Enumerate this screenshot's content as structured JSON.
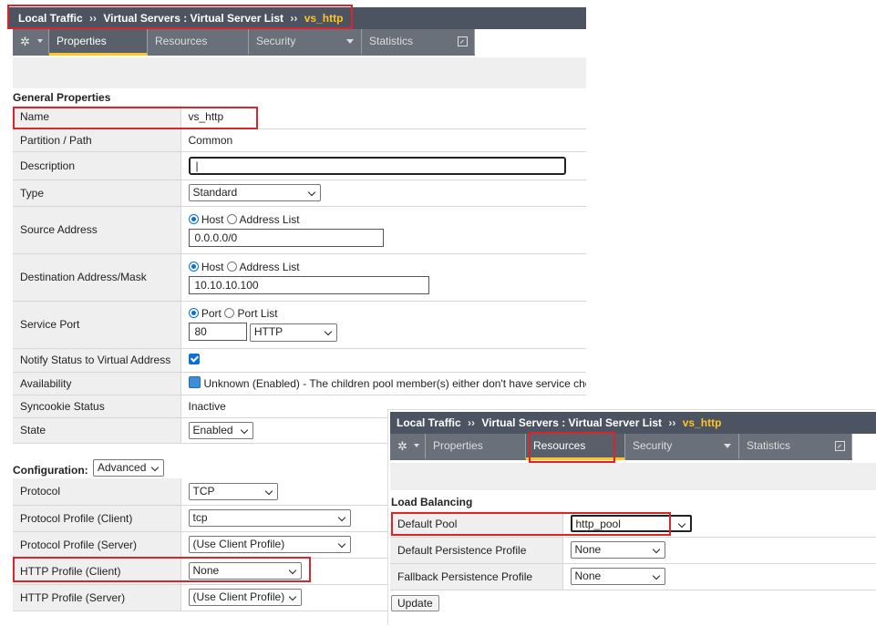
{
  "properties_panel": {
    "breadcrumb": {
      "part1": "Local Traffic",
      "sep": "››",
      "part2": "Virtual Servers : Virtual Server List",
      "current": "vs_http"
    },
    "tabs": {
      "properties": "Properties",
      "resources": "Resources",
      "security": "Security",
      "statistics": "Statistics"
    },
    "general_title": "General Properties",
    "name_label": "Name",
    "name_value": "vs_http",
    "partition_label": "Partition / Path",
    "partition_value": "Common",
    "description_label": "Description",
    "description_value": "|",
    "type_label": "Type",
    "type_value": "Standard",
    "source_label": "Source Address",
    "source_host": "Host",
    "source_list": "Address List",
    "source_value": "0.0.0.0/0",
    "dest_label": "Destination Address/Mask",
    "dest_host": "Host",
    "dest_list": "Address List",
    "dest_value": "10.10.10.100",
    "port_label": "Service Port",
    "port_opt": "Port",
    "port_list": "Port List",
    "port_value": "80",
    "port_service": "HTTP",
    "notify_label": "Notify Status to Virtual Address",
    "availability_label": "Availability",
    "availability_value": "Unknown (Enabled) - The children pool member(s) either don't have service che",
    "syncookie_label": "Syncookie Status",
    "syncookie_value": "Inactive",
    "state_label": "State",
    "state_value": "Enabled",
    "config_label": "Configuration:",
    "config_mode": "Advanced",
    "protocol_label": "Protocol",
    "protocol_value": "TCP",
    "pp_client_label": "Protocol Profile (Client)",
    "pp_client_value": "tcp",
    "pp_server_label": "Protocol Profile (Server)",
    "pp_server_value": "(Use Client Profile)",
    "http_client_label": "HTTP Profile (Client)",
    "http_client_value": "None",
    "http_server_label": "HTTP Profile (Server)",
    "http_server_value": "(Use Client Profile)"
  },
  "resources_panel": {
    "breadcrumb": {
      "part1": "Local Traffic",
      "sep": "››",
      "part2": "Virtual Servers : Virtual Server List",
      "current": "vs_http"
    },
    "tabs": {
      "properties": "Properties",
      "resources": "Resources",
      "security": "Security",
      "statistics": "Statistics"
    },
    "lb_title": "Load Balancing",
    "default_pool_label": "Default Pool",
    "default_pool_value": "http_pool",
    "default_persist_label": "Default Persistence Profile",
    "default_persist_value": "None",
    "fallback_persist_label": "Fallback Persistence Profile",
    "fallback_persist_value": "None",
    "update_button": "Update"
  },
  "colors": {
    "highlight": "#d9262c",
    "accent": "#ffc425",
    "header": "#4b5460"
  },
  "icons": {
    "settings": "gear-icon",
    "external": "external-link-icon"
  }
}
